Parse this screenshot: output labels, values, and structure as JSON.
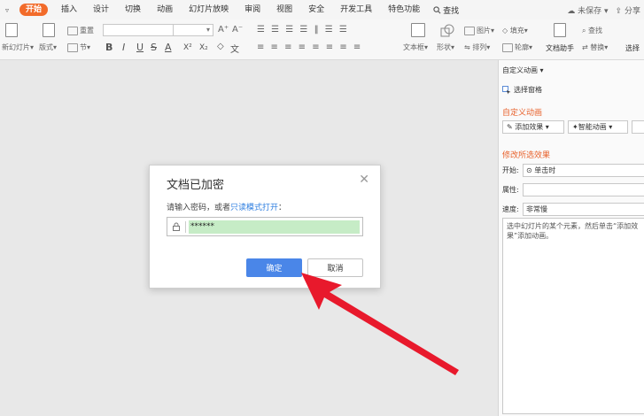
{
  "menubar": {
    "tabs": [
      "开始",
      "插入",
      "设计",
      "切换",
      "动画",
      "幻灯片放映",
      "审阅",
      "视图",
      "安全",
      "开发工具",
      "特色功能"
    ],
    "active_tab": "开始",
    "search_label": "查找",
    "unsaved_label": "未保存",
    "share_label": "分享"
  },
  "ribbon": {
    "new_slide": "新幻灯片",
    "layout": "版式",
    "section": "节",
    "reset": "重置",
    "bold": "B",
    "italic": "I",
    "underline": "U",
    "strike": "S",
    "font_color": "A",
    "superscript": "X²",
    "subscript": "X₂",
    "grow_font": "A⁺",
    "shrink_font": "A⁻",
    "textbox": "文本框",
    "shape": "形状",
    "arrange": "排列",
    "picture": "图片",
    "fill": "填充",
    "outline": "轮廓",
    "doc_assistant": "文档助手",
    "find": "查找",
    "replace": "替换",
    "select": "选择"
  },
  "dialog": {
    "title": "文档已加密",
    "prompt_prefix": "请输入密码，或者",
    "prompt_link": "只读模式打开",
    "prompt_suffix": "：",
    "password_value": "******",
    "ok_label": "确定",
    "cancel_label": "取消"
  },
  "pane": {
    "header": "自定义动画",
    "select_pane": "选择窗格",
    "section_custom": "自定义动画",
    "add_effect": "添加效果",
    "smart_animation": "智能动画",
    "section_modify": "修改所选效果",
    "start_label": "开始:",
    "start_value": "单击时",
    "property_label": "属性:",
    "property_value": "",
    "speed_label": "速度:",
    "speed_value": "非常慢",
    "description": "选中幻灯片的某个元素，然后单击“添加效果”添加动画。"
  },
  "colors": {
    "accent_orange": "#f26b2a",
    "primary_blue": "#4a86e8",
    "link_blue": "#2f7fe0",
    "pw_highlight": "#c6ecc6",
    "arrow_red": "#e8192c"
  }
}
